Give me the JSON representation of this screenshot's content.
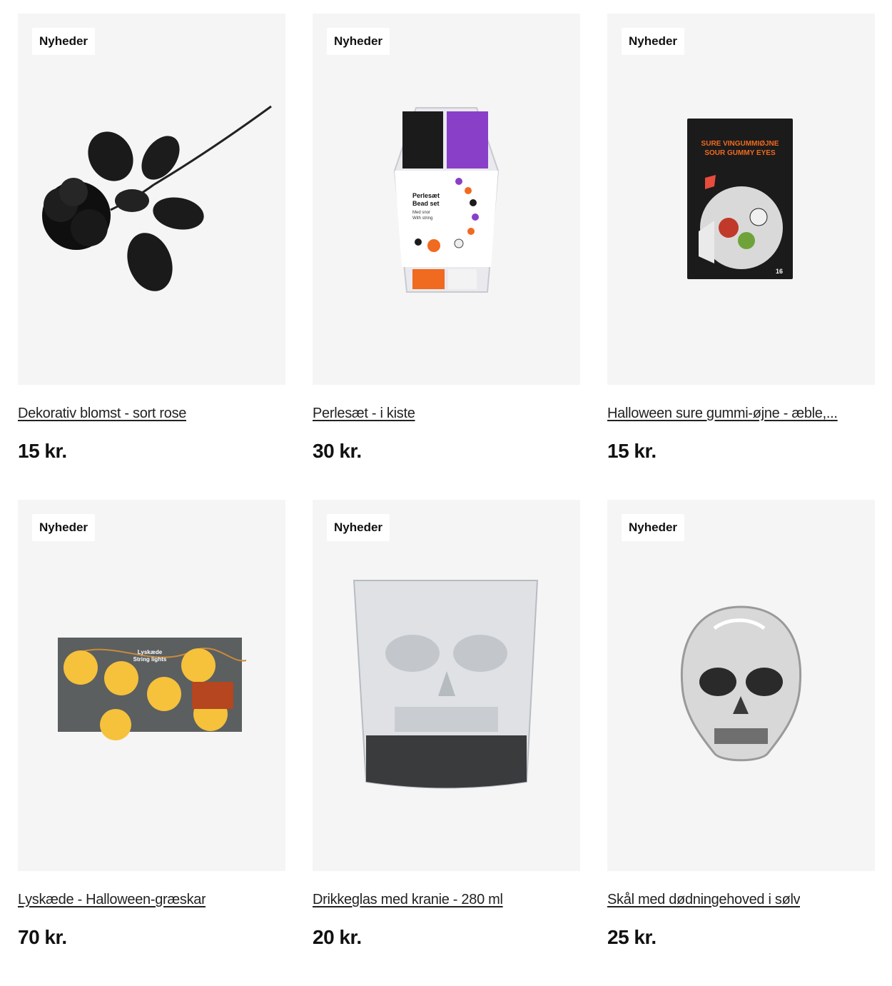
{
  "products": [
    {
      "badge": "Nyheder",
      "title": "Dekorativ blomst - sort rose",
      "price": "15 kr.",
      "image": "black-rose"
    },
    {
      "badge": "Nyheder",
      "title": "Perlesæt - i kiste",
      "price": "30 kr.",
      "image": "bead-set-coffin",
      "package_text": {
        "line1": "Perlesæt",
        "line2": "Bead set",
        "line3": "Med snor",
        "line4": "With string"
      }
    },
    {
      "badge": "Nyheder",
      "title": "Halloween sure gummi-øjne - æble,...",
      "price": "15 kr.",
      "image": "sour-gummy-eyes",
      "package_text": {
        "line1": "SURE VINGUMMIØJNE",
        "line2": "SOUR GUMMY EYES",
        "count": "16"
      }
    },
    {
      "badge": "Nyheder",
      "title": "Lyskæde - Halloween-græskar",
      "price": "70 kr.",
      "image": "pumpkin-string-lights",
      "package_text": {
        "line1": "Lyskæde",
        "line2": "String lights"
      }
    },
    {
      "badge": "Nyheder",
      "title": "Drikkeglas med kranie - 280 ml",
      "price": "20 kr.",
      "image": "skull-glass"
    },
    {
      "badge": "Nyheder",
      "title": "Skål med dødningehoved i sølv",
      "price": "25 kr.",
      "image": "silver-skull-bowl"
    }
  ]
}
